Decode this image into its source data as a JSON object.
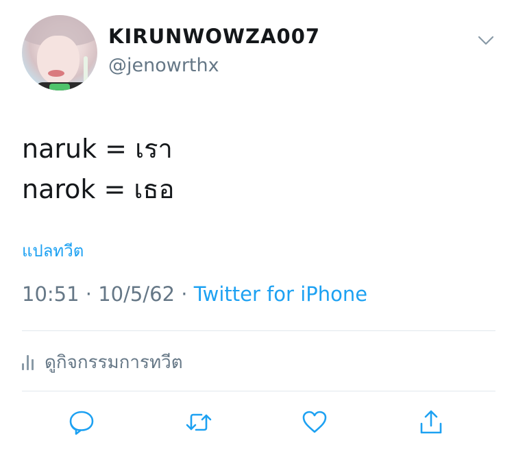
{
  "user": {
    "display_name": "KIRUNWOWZA007",
    "username": "@jenowrthx",
    "avatar_icon": "profile-photo"
  },
  "tweet": {
    "lines": [
      "naruk = เรา",
      "narok = เธอ"
    ],
    "translate_label": "แปลทวีต",
    "time": "10:51",
    "date": "10/5/62",
    "separator": "·",
    "source": "Twitter for iPhone"
  },
  "activity": {
    "label": "ดูกิจกรรมการทวีต",
    "icon": "analytics-bars-icon"
  },
  "actions": [
    {
      "name": "reply",
      "icon": "speech-bubble-icon"
    },
    {
      "name": "retweet",
      "icon": "retweet-arrows-icon"
    },
    {
      "name": "like",
      "icon": "heart-icon"
    },
    {
      "name": "share",
      "icon": "share-upload-icon"
    }
  ],
  "colors": {
    "accent": "#1da1f2",
    "secondary_text": "#657786",
    "icon": "#1da1f2",
    "divider": "#e1e8ed"
  }
}
